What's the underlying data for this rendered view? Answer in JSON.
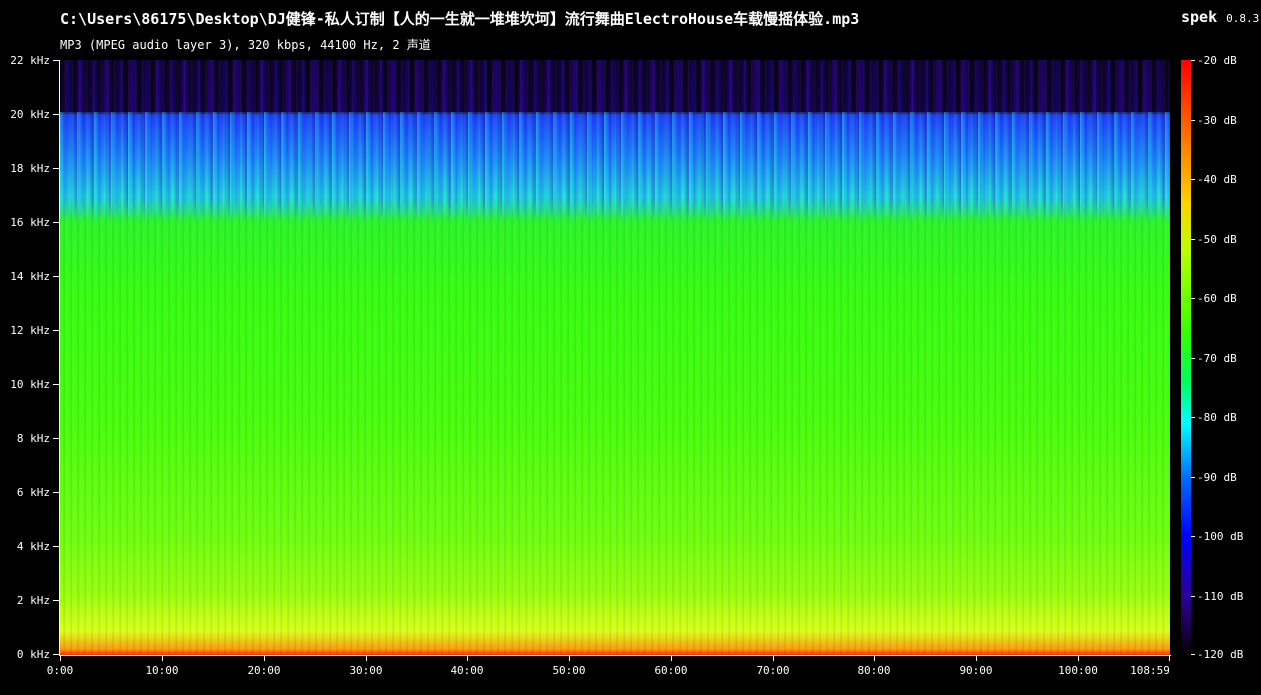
{
  "header": {
    "file_path": "C:\\Users\\86175\\Desktop\\DJ健锋-私人订制【人的一生就一堆堆坎坷】流行舞曲ElectroHouse车载慢摇体验.mp3",
    "app_name": "spek",
    "app_version": "0.8.3",
    "file_info": "MP3 (MPEG audio layer 3), 320 kbps, 44100 Hz, 2 声道"
  },
  "frequency_axis": {
    "labels": [
      "22 kHz",
      "20 kHz",
      "18 kHz",
      "16 kHz",
      "14 kHz",
      "12 kHz",
      "10 kHz",
      "8 kHz",
      "6 kHz",
      "4 kHz",
      "2 kHz",
      "0 kHz"
    ]
  },
  "time_axis": {
    "labels": [
      "0:00",
      "10:00",
      "20:00",
      "30:00",
      "40:00",
      "50:00",
      "60:00",
      "70:00",
      "80:00",
      "90:00",
      "100:00",
      "108:59"
    ]
  },
  "db_scale": {
    "labels": [
      "-20 dB",
      "-30 dB",
      "-40 dB",
      "-50 dB",
      "-60 dB",
      "-70 dB",
      "-80 dB",
      "-90 dB",
      "-100 dB",
      "-110 dB",
      "-120 dB"
    ]
  },
  "colors": {
    "background": "#000000",
    "text": "#ffffff"
  }
}
